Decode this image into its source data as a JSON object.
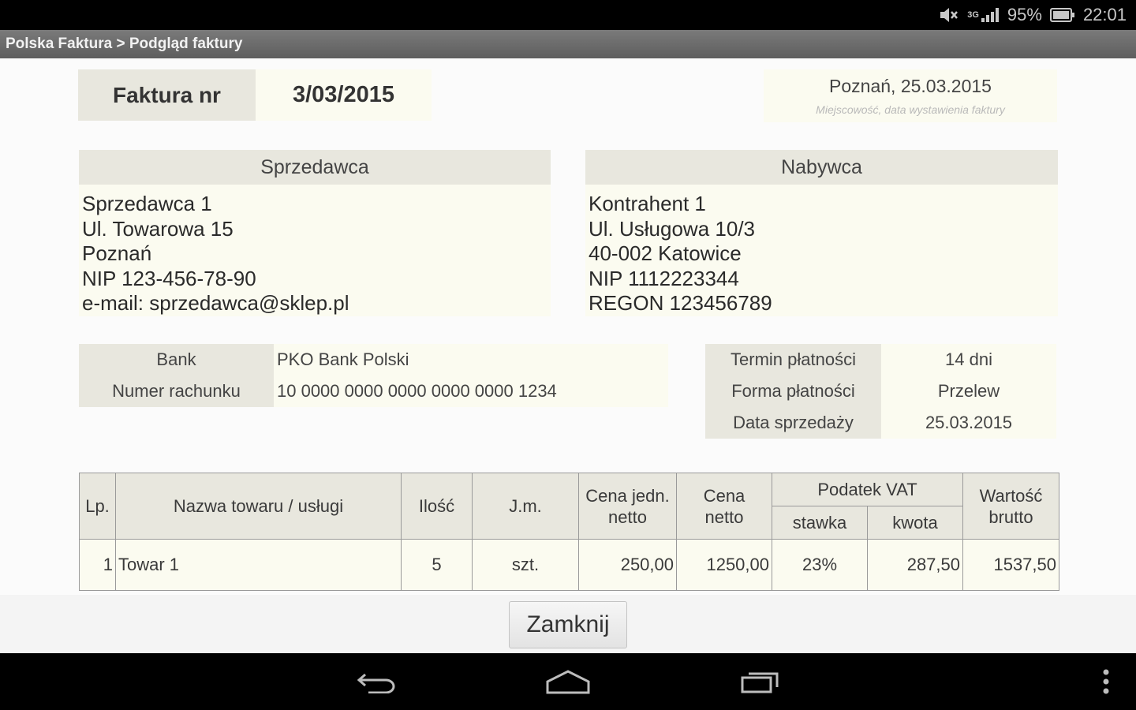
{
  "statusbar": {
    "battery": "95%",
    "time": "22:01",
    "signal_label": "3G"
  },
  "titlebar": {
    "title": "Polska Faktura > Podgląd faktury"
  },
  "invoice": {
    "number_label": "Faktura nr",
    "number": "3/03/2015",
    "place_date": "Poznań, 25.03.2015",
    "place_date_caption": "Miejscowość, data wystawienia faktury"
  },
  "seller": {
    "header": "Sprzedawca",
    "lines": [
      "Sprzedawca 1",
      "Ul. Towarowa 15",
      "Poznań",
      "NIP 123-456-78-90",
      "e-mail: sprzedawca@sklep.pl"
    ]
  },
  "buyer": {
    "header": "Nabywca",
    "lines": [
      "Kontrahent 1",
      "Ul. Usługowa 10/3",
      "40-002 Katowice",
      "NIP 1112223344",
      "REGON 123456789"
    ]
  },
  "bank": {
    "bank_label": "Bank",
    "bank_value": "PKO Bank Polski",
    "account_label": "Numer rachunku",
    "account_value": "10 0000 0000 0000 0000 0000 1234"
  },
  "payment": {
    "term_label": "Termin płatności",
    "term_value": "14 dni",
    "form_label": "Forma płatności",
    "form_value": "Przelew",
    "sale_date_label": "Data sprzedaży",
    "sale_date_value": "25.03.2015"
  },
  "table": {
    "headers": {
      "lp": "Lp.",
      "name": "Nazwa towaru / usługi",
      "qty": "Ilość",
      "unit": "J.m.",
      "unit_price_1": "Cena jedn.",
      "unit_price_2": "netto",
      "net_1": "Cena",
      "net_2": "netto",
      "vat": "Podatek VAT",
      "vat_rate": "stawka",
      "vat_amount": "kwota",
      "gross_1": "Wartość",
      "gross_2": "brutto"
    },
    "rows": [
      {
        "lp": "1",
        "name": "Towar 1",
        "qty": "5",
        "unit": "szt.",
        "unit_price": "250,00",
        "net": "1250,00",
        "vat_rate": "23%",
        "vat_amount": "287,50",
        "gross": "1537,50"
      }
    ]
  },
  "actions": {
    "close_label": "Zamknij"
  },
  "icons": {
    "mute": "speaker-muted-icon",
    "signal": "signal-icon",
    "battery": "battery-icon",
    "back": "back-icon",
    "home": "home-icon",
    "recents": "recent-apps-icon",
    "menu": "overflow-menu-icon"
  }
}
